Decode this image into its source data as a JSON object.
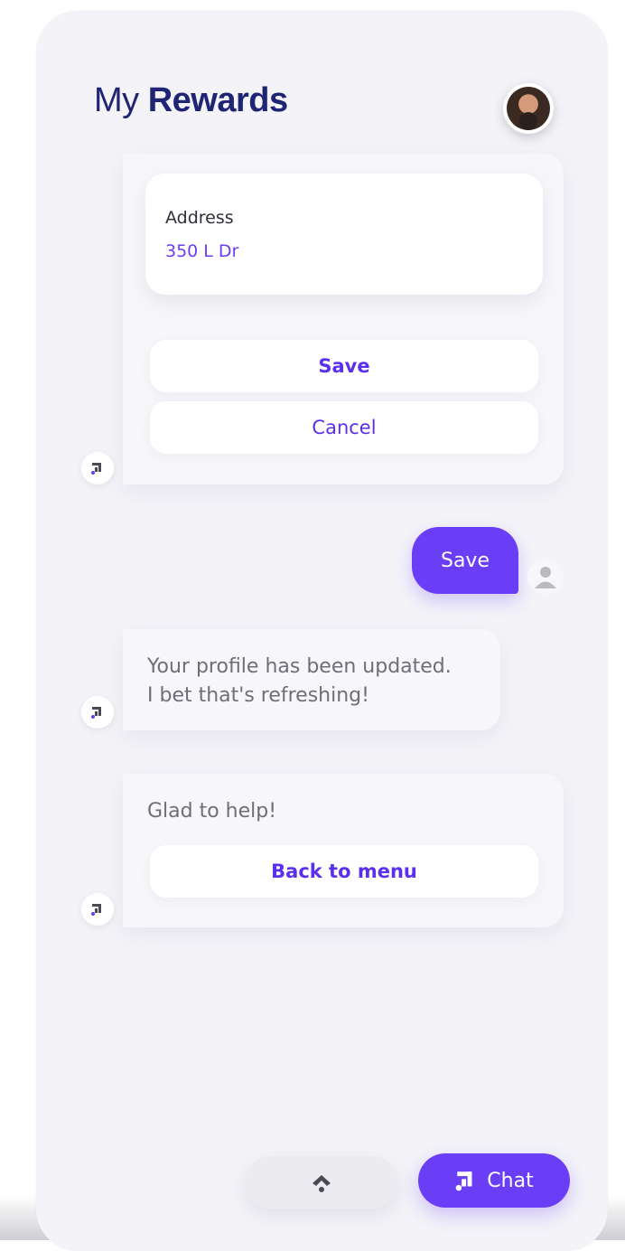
{
  "header": {
    "title_light": "My",
    "title_bold": "Rewards"
  },
  "address_card": {
    "field_label": "Address",
    "field_value": "350 L Dr",
    "save_label": "Save",
    "cancel_label": "Cancel"
  },
  "user_message": {
    "text": "Save"
  },
  "bot_message_1": {
    "line1": "Your profile has been updated.",
    "line2": "I bet that's refreshing!"
  },
  "bot_message_2": {
    "text": "Glad to help!",
    "button_label": "Back to menu"
  },
  "footer": {
    "chat_label": "Chat"
  },
  "colors": {
    "accent": "#6a3df6",
    "title": "#1f2573",
    "background": "#f3f3f8"
  },
  "icons": [
    "bot-logo-icon",
    "user-icon",
    "chevron-up-icon",
    "avatar"
  ]
}
